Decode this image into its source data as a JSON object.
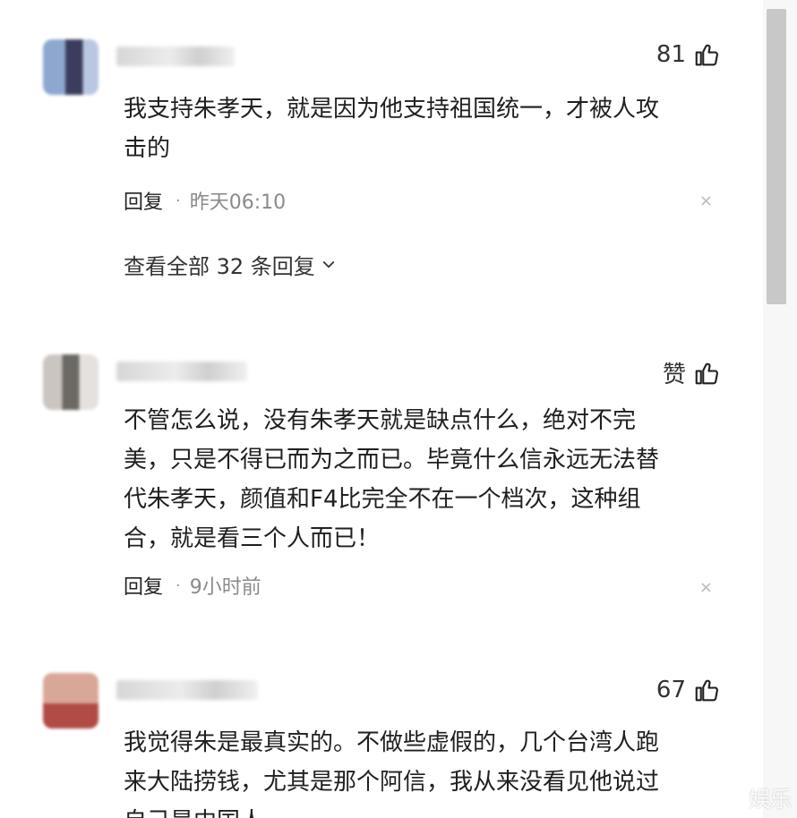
{
  "comments": [
    {
      "likes": "81",
      "text": "我支持朱孝天，就是因为他支持祖国统一，才被人攻\n击的",
      "reply_label": "回复",
      "separator": "·",
      "time": "昨天06:10",
      "close": "×",
      "view_all": "查看全部 32 条回复"
    },
    {
      "likes": "赞",
      "text": "不管怎么说，没有朱孝天就是缺点什么，绝对不完\n美，只是不得已而为之而已。毕竟什么信永远无法替\n代朱孝天，颜值和F4比完全不在一个档次，这种组\n合，就是看三个人而已！",
      "reply_label": "回复",
      "separator": "·",
      "time": "9小时前",
      "close": "×"
    },
    {
      "likes": "67",
      "text": "我觉得朱是最真实的。不做些虚假的，几个台湾人跑\n来大陆捞钱，尤其是那个阿信，我从来没看见他说过\n自己是中国人"
    }
  ],
  "watermark": "娱乐",
  "icons": {
    "like": "thumb-up-icon",
    "expand": "chevron-down-icon",
    "dismiss": "close-icon"
  },
  "colors": {
    "text": "#1f1f1f",
    "meta": "#8a8a8a",
    "scroll_thumb": "#c8c8c8"
  }
}
